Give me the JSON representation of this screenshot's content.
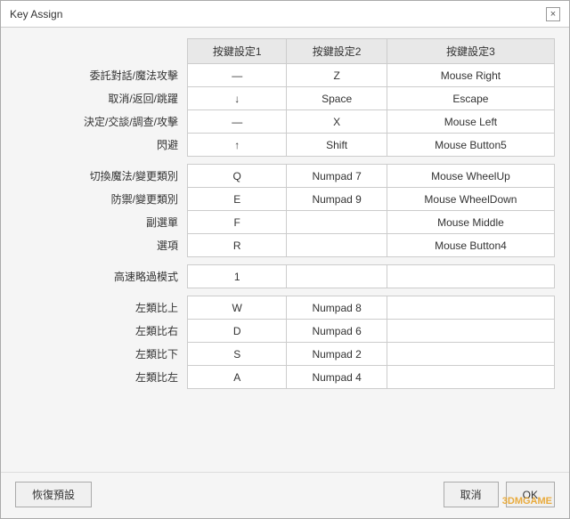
{
  "window": {
    "title": "Key Assign",
    "close_label": "×"
  },
  "table": {
    "headers": [
      "",
      "按鍵設定1",
      "按鍵設定2",
      "按鍵設定3"
    ],
    "rows": [
      {
        "label": "委託對話/魔法攻擊",
        "col1": "—",
        "col2": "Z",
        "col3": "Mouse Right",
        "spacer_before": false
      },
      {
        "label": "取消/返回/跳躍",
        "col1": "↓",
        "col2": "Space",
        "col3": "Escape",
        "spacer_before": false
      },
      {
        "label": "決定/交談/調查/攻擊",
        "col1": "—",
        "col2": "X",
        "col3": "Mouse Left",
        "spacer_before": false
      },
      {
        "label": "閃避",
        "col1": "↑",
        "col2": "Shift",
        "col3": "Mouse Button5",
        "spacer_before": false
      },
      {
        "label": "",
        "col1": "",
        "col2": "",
        "col3": "",
        "spacer_before": true
      },
      {
        "label": "切換魔法/變更類別",
        "col1": "Q",
        "col2": "Numpad 7",
        "col3": "Mouse WheelUp",
        "spacer_before": false
      },
      {
        "label": "防禦/變更類別",
        "col1": "E",
        "col2": "Numpad 9",
        "col3": "Mouse WheelDown",
        "spacer_before": false
      },
      {
        "label": "副選單",
        "col1": "F",
        "col2": "",
        "col3": "Mouse Middle",
        "spacer_before": false
      },
      {
        "label": "選項",
        "col1": "R",
        "col2": "",
        "col3": "Mouse Button4",
        "spacer_before": false
      },
      {
        "label": "",
        "col1": "",
        "col2": "",
        "col3": "",
        "spacer_before": true
      },
      {
        "label": "高速略過模式",
        "col1": "1",
        "col2": "",
        "col3": "",
        "spacer_before": false
      },
      {
        "label": "",
        "col1": "",
        "col2": "",
        "col3": "",
        "spacer_before": true
      },
      {
        "label": "左類比上",
        "col1": "W",
        "col2": "Numpad 8",
        "col3": "",
        "spacer_before": false
      },
      {
        "label": "左類比右",
        "col1": "D",
        "col2": "Numpad 6",
        "col3": "",
        "spacer_before": false
      },
      {
        "label": "左類比下",
        "col1": "S",
        "col2": "Numpad 2",
        "col3": "",
        "spacer_before": false
      },
      {
        "label": "左類比左",
        "col1": "A",
        "col2": "Numpad 4",
        "col3": "",
        "spacer_before": false
      }
    ]
  },
  "footer": {
    "reset_label": "恢復預設",
    "cancel_label": "取消",
    "ok_label": "OK"
  },
  "watermark": "3DMGAME"
}
